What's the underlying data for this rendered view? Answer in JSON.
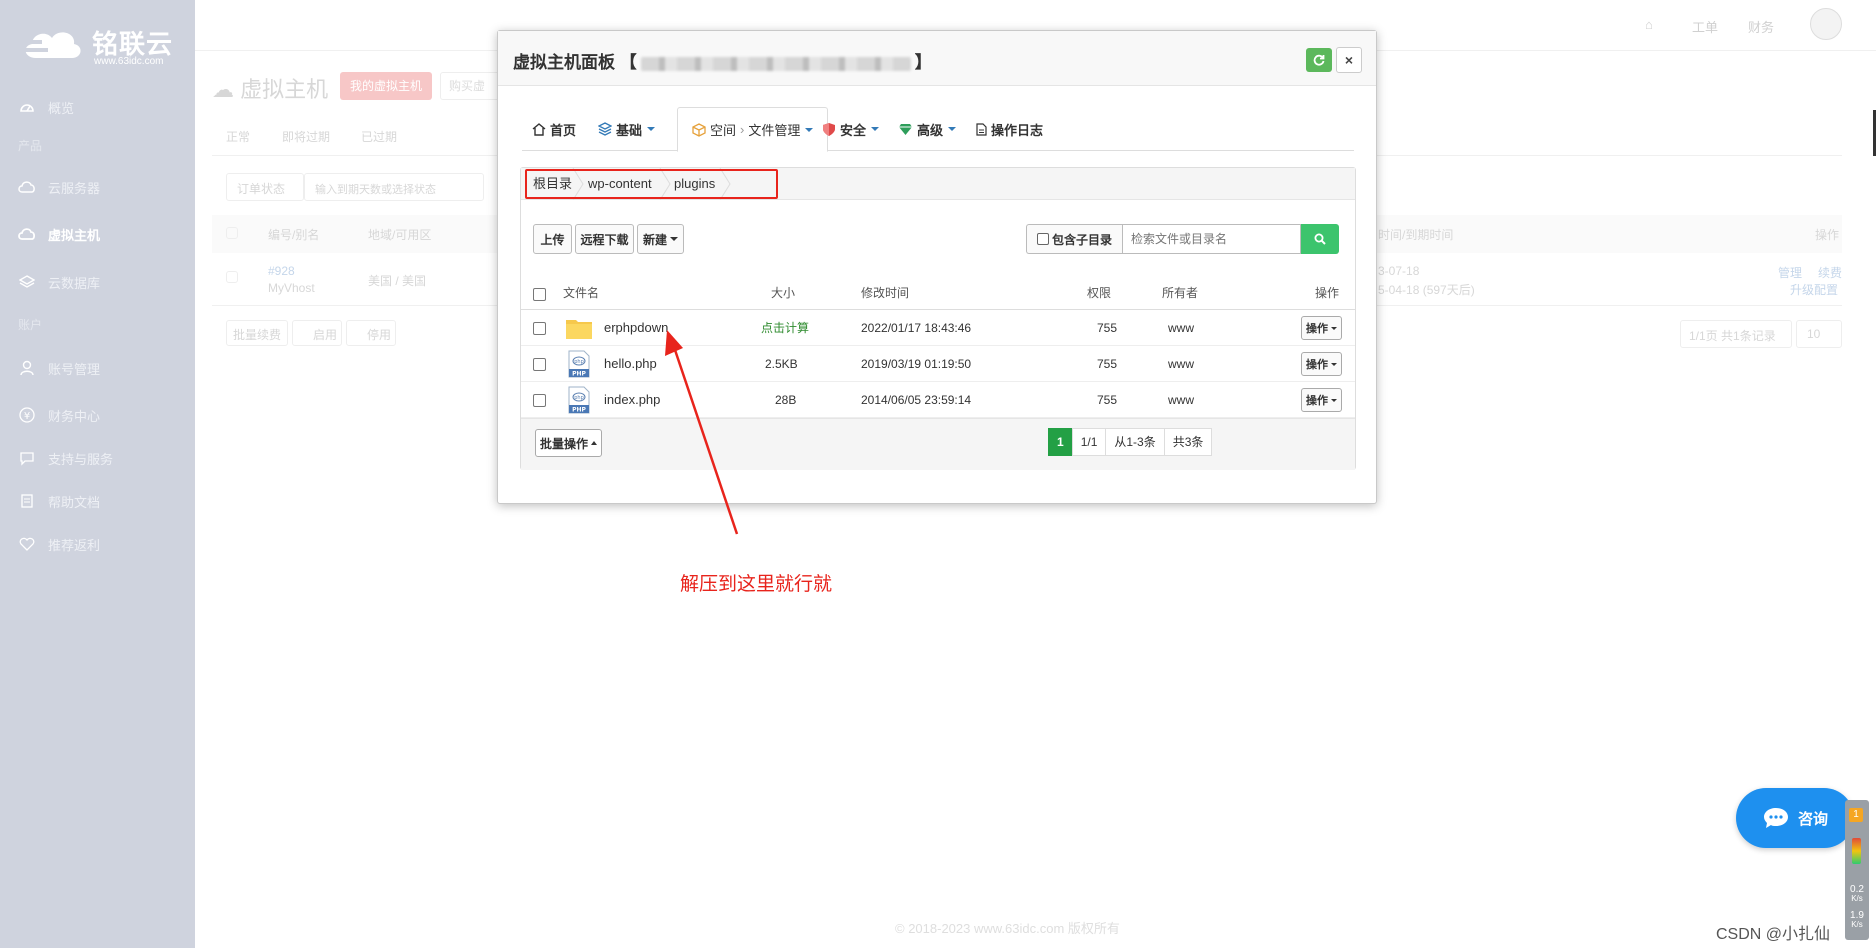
{
  "brand": {
    "name": "铭联云",
    "site": "www.63idc.com"
  },
  "sidebar": {
    "items": [
      {
        "label": "概览",
        "icon": "dashboard-icon"
      },
      {
        "group": "产品"
      },
      {
        "label": "云服务器",
        "icon": "cloud-icon"
      },
      {
        "label": "虚拟主机",
        "icon": "cloud-icon",
        "active": true
      },
      {
        "label": "云数据库",
        "icon": "layers-icon"
      },
      {
        "group": "账户"
      },
      {
        "label": "账号管理",
        "icon": "user-icon"
      },
      {
        "label": "财务中心",
        "icon": "yen-icon"
      },
      {
        "label": "支持与服务",
        "icon": "chat-icon"
      },
      {
        "label": "帮助文档",
        "icon": "doc-icon"
      },
      {
        "label": "推荐返利",
        "icon": "heart-icon"
      }
    ]
  },
  "topbar": {
    "ticket": "工单",
    "finance": "财务"
  },
  "background": {
    "page_title": "虚拟主机",
    "my_host_button": "我的虚拟主机",
    "buy_button": "购买虚",
    "tabs": [
      "正常",
      "即将过期",
      "已过期"
    ],
    "status_filter": "订单状态",
    "filter_placeholder": "输入到期天数或选择状态",
    "col_id": "编号/别名",
    "col_region": "地域/可用区",
    "col_time": "时间/到期时间",
    "col_op": "操作",
    "row_id": "#928",
    "row_alias": "MyVhost",
    "row_region": "美国 / 美国",
    "row_date": "3-07-18",
    "row_expire": "5-04-18 (597天后)",
    "row_manage": "管理",
    "row_renew": "续费",
    "row_upgrade": "升级配置",
    "batch_renew": "批量续费",
    "enable": "启用",
    "disable": "停用",
    "page_info": "1/1页 共1条记录",
    "page_size": "10"
  },
  "modal": {
    "title": "虚拟主机面板",
    "tabs": {
      "home": "首页",
      "basic": "基础",
      "space": "空间",
      "file_mgmt": "文件管理",
      "security": "安全",
      "advanced": "高级",
      "log": "操作日志"
    },
    "breadcrumb": [
      "根目录",
      "wp-content",
      "plugins"
    ],
    "toolbar": {
      "upload": "上传",
      "remote_download": "远程下载",
      "new": "新建",
      "include_sub": "包含子目录",
      "search_placeholder": "检索文件或目录名"
    },
    "columns": {
      "name": "文件名",
      "size": "大小",
      "mtime": "修改时间",
      "perm": "权限",
      "owner": "所有者",
      "op": "操作"
    },
    "files": [
      {
        "name": "erphpdown",
        "type": "folder",
        "size": "点击计算",
        "mtime": "2022/01/17 18:43:46",
        "perm": "755",
        "owner": "www",
        "op": "操作"
      },
      {
        "name": "hello.php",
        "type": "php",
        "size": "2.5KB",
        "mtime": "2019/03/19 01:19:50",
        "perm": "755",
        "owner": "www",
        "op": "操作"
      },
      {
        "name": "index.php",
        "type": "php",
        "size": "28B",
        "mtime": "2014/06/05 23:59:14",
        "perm": "755",
        "owner": "www",
        "op": "操作"
      }
    ],
    "batch_op": "批量操作",
    "pager": {
      "current": "1",
      "pages": "1/1",
      "range": "从1-3条",
      "total": "共3条"
    }
  },
  "annotation": "解压到这里就行就",
  "consult": "咨询",
  "footer": "© 2018-2023 www.63idc.com 版权所有",
  "watermark": "CSDN @小扎仙",
  "monitor": {
    "badge": "1",
    "up": "0.2",
    "up_unit": "K/s",
    "down": "1.9",
    "down_unit": "K/s"
  },
  "colors": {
    "accent_green": "#23a045",
    "search_green": "#3cc46d",
    "annotation_red": "#e8241c",
    "consult_blue": "#1e90ef"
  }
}
